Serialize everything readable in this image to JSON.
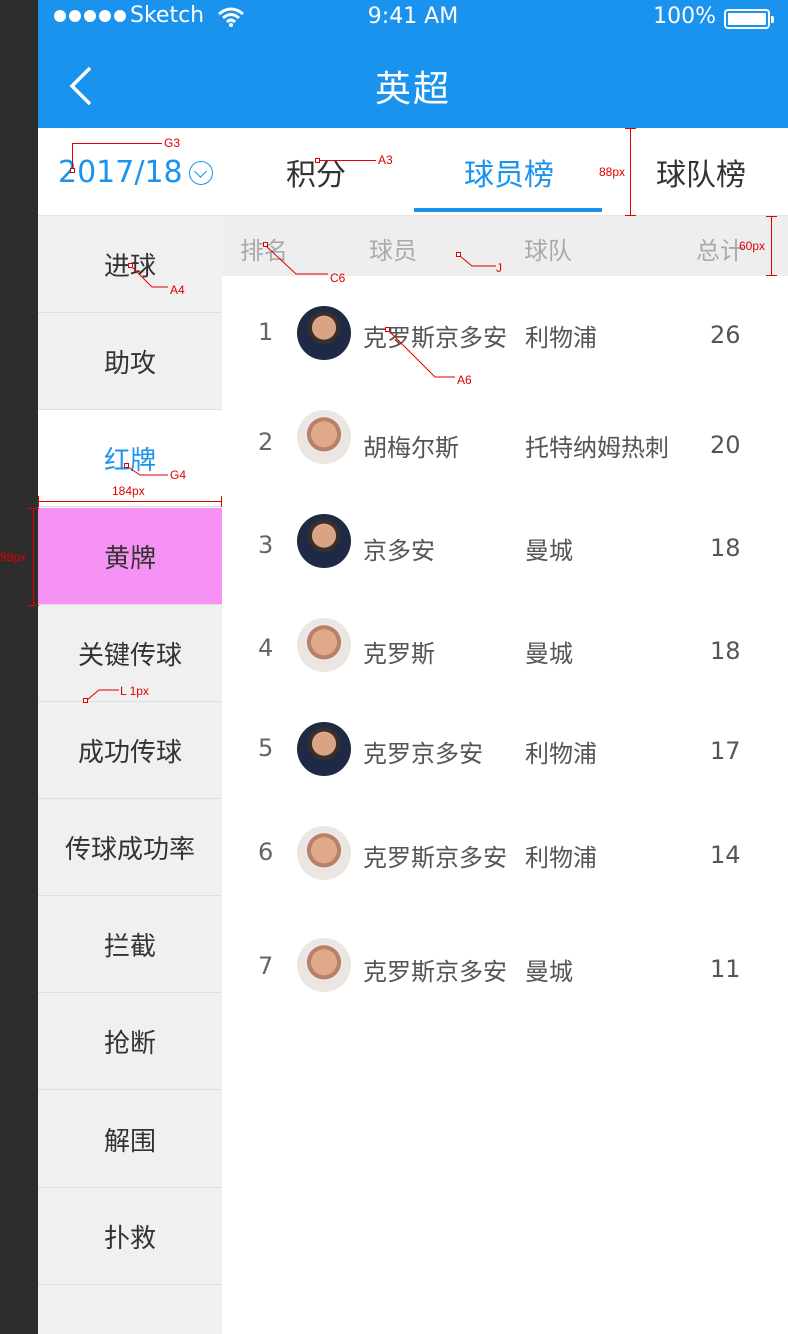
{
  "status_bar": {
    "carrier": "Sketch",
    "time": "9:41 AM",
    "battery": "100%"
  },
  "header": {
    "title": "英超"
  },
  "season_selector": {
    "value": "2017/18"
  },
  "tabs": [
    {
      "label": "积分",
      "active": false
    },
    {
      "label": "球员榜",
      "active": true
    },
    {
      "label": "球队榜",
      "active": false
    }
  ],
  "sidebar": {
    "items": [
      {
        "label": "进球"
      },
      {
        "label": "助攻"
      },
      {
        "label": "红牌",
        "active": true
      },
      {
        "label": "黄牌"
      },
      {
        "label": "关键传球"
      },
      {
        "label": "成功传球"
      },
      {
        "label": "传球成功率"
      },
      {
        "label": "拦截"
      },
      {
        "label": "抢断"
      },
      {
        "label": "解围"
      },
      {
        "label": "扑救"
      }
    ]
  },
  "table": {
    "headers": {
      "rank": "排名",
      "player": "球员",
      "team": "球队",
      "total": "总计"
    },
    "rows": [
      {
        "rank": "1",
        "player": "克罗斯京多安",
        "team": "利物浦",
        "total": "26",
        "avatar": "player-a"
      },
      {
        "rank": "2",
        "player": "胡梅尔斯",
        "team": "托特纳姆热刺",
        "total": "20",
        "avatar": "player-b"
      },
      {
        "rank": "3",
        "player": "京多安",
        "team": "曼城",
        "total": "18",
        "avatar": "player-a"
      },
      {
        "rank": "4",
        "player": "克罗斯",
        "team": "曼城",
        "total": "18",
        "avatar": "player-b"
      },
      {
        "rank": "5",
        "player": "克罗京多安",
        "team": "利物浦",
        "total": "17",
        "avatar": "player-a"
      },
      {
        "rank": "6",
        "player": "克罗斯京多安",
        "team": "利物浦",
        "total": "14",
        "avatar": "player-b"
      },
      {
        "rank": "7",
        "player": "克罗斯京多安",
        "team": "曼城",
        "total": "11",
        "avatar": "player-b"
      }
    ]
  },
  "annotations": {
    "g3": "G3",
    "a3": "A3",
    "h88": "88px",
    "h60": "60px",
    "c6": "C6",
    "j": "J",
    "a4": "A4",
    "a6": "A6",
    "g4": "G4",
    "w184": "184px",
    "h98": "98px",
    "l1": "L 1px"
  },
  "colors": {
    "primary": "#1a93ef",
    "highlight": "#f792f5",
    "annotation": "#e00000"
  }
}
